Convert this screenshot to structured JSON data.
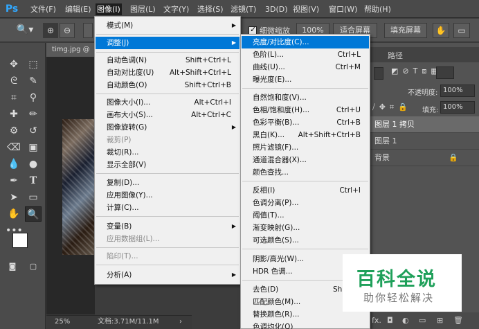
{
  "app": {
    "logo": "Ps"
  },
  "menubar": {
    "items": [
      {
        "label": "文件(F)"
      },
      {
        "label": "编辑(E)"
      },
      {
        "label": "图像(I)"
      },
      {
        "label": "图层(L)"
      },
      {
        "label": "文字(Y)"
      },
      {
        "label": "选择(S)"
      },
      {
        "label": "滤镜(T)"
      },
      {
        "label": "3D(D)"
      },
      {
        "label": "视图(V)"
      },
      {
        "label": "窗口(W)"
      },
      {
        "label": "帮助(H)"
      }
    ]
  },
  "options": {
    "scrubby_label": "细微缩放",
    "zoom_value": "100%",
    "fit_screen": "适合屏幕",
    "fill_screen": "填充屏幕"
  },
  "document": {
    "tab_title": "timg.jpg @",
    "zoom": "25%",
    "doc_size": "文档:3.71M/11.1M"
  },
  "image_menu": {
    "items": [
      {
        "label": "模式(M)",
        "shortcut": "",
        "submenu": true
      },
      {
        "label": "调整(J)",
        "shortcut": "",
        "submenu": true,
        "highlight": true
      },
      {
        "label": "自动色调(N)",
        "shortcut": "Shift+Ctrl+L"
      },
      {
        "label": "自动对比度(U)",
        "shortcut": "Alt+Shift+Ctrl+L"
      },
      {
        "label": "自动颜色(O)",
        "shortcut": "Shift+Ctrl+B"
      },
      {
        "label": "图像大小(I)...",
        "shortcut": "Alt+Ctrl+I"
      },
      {
        "label": "画布大小(S)...",
        "shortcut": "Alt+Ctrl+C"
      },
      {
        "label": "图像旋转(G)",
        "shortcut": "",
        "submenu": true
      },
      {
        "label": "裁剪(P)",
        "shortcut": "",
        "disabled": true
      },
      {
        "label": "裁切(R)...",
        "shortcut": ""
      },
      {
        "label": "显示全部(V)",
        "shortcut": ""
      },
      {
        "label": "复制(D)...",
        "shortcut": ""
      },
      {
        "label": "应用图像(Y)...",
        "shortcut": ""
      },
      {
        "label": "计算(C)...",
        "shortcut": ""
      },
      {
        "label": "变量(B)",
        "shortcut": "",
        "submenu": true
      },
      {
        "label": "应用数据组(L)...",
        "shortcut": "",
        "disabled": true
      },
      {
        "label": "陷印(T)...",
        "shortcut": "",
        "disabled": true
      },
      {
        "label": "分析(A)",
        "shortcut": "",
        "submenu": true
      }
    ]
  },
  "adjust_menu": {
    "items": [
      {
        "label": "亮度/对比度(C)...",
        "shortcut": "",
        "highlight": true
      },
      {
        "label": "色阶(L)...",
        "shortcut": "Ctrl+L"
      },
      {
        "label": "曲线(U)...",
        "shortcut": "Ctrl+M"
      },
      {
        "label": "曝光度(E)...",
        "shortcut": ""
      },
      {
        "label": "自然饱和度(V)...",
        "shortcut": ""
      },
      {
        "label": "色相/饱和度(H)...",
        "shortcut": "Ctrl+U"
      },
      {
        "label": "色彩平衡(B)...",
        "shortcut": "Ctrl+B"
      },
      {
        "label": "黑白(K)...",
        "shortcut": "Alt+Shift+Ctrl+B"
      },
      {
        "label": "照片滤镜(F)...",
        "shortcut": ""
      },
      {
        "label": "通道混合器(X)...",
        "shortcut": ""
      },
      {
        "label": "颜色查找...",
        "shortcut": ""
      },
      {
        "label": "反相(I)",
        "shortcut": "Ctrl+I"
      },
      {
        "label": "色调分离(P)...",
        "shortcut": ""
      },
      {
        "label": "阈值(T)...",
        "shortcut": ""
      },
      {
        "label": "渐变映射(G)...",
        "shortcut": ""
      },
      {
        "label": "可选颜色(S)...",
        "shortcut": ""
      },
      {
        "label": "阴影/高光(W)...",
        "shortcut": ""
      },
      {
        "label": "HDR 色调...",
        "shortcut": ""
      },
      {
        "label": "去色(D)",
        "shortcut": "Shift+C"
      },
      {
        "label": "匹配颜色(M)...",
        "shortcut": ""
      },
      {
        "label": "替换颜色(R)...",
        "shortcut": ""
      },
      {
        "label": "色调均化(Q)",
        "shortcut": ""
      }
    ]
  },
  "layers_panel": {
    "tab_paths": "路径",
    "opacity_label": "不透明度:",
    "opacity_value": "100%",
    "fill_label": "填充:",
    "fill_value": "100%",
    "layers": [
      {
        "name": "图层 1 拷贝"
      },
      {
        "name": "图层 1"
      },
      {
        "name": "背景"
      }
    ],
    "fx_label": "fx."
  },
  "watermark": {
    "title": "百科全说",
    "subtitle": "助你轻松解决"
  }
}
